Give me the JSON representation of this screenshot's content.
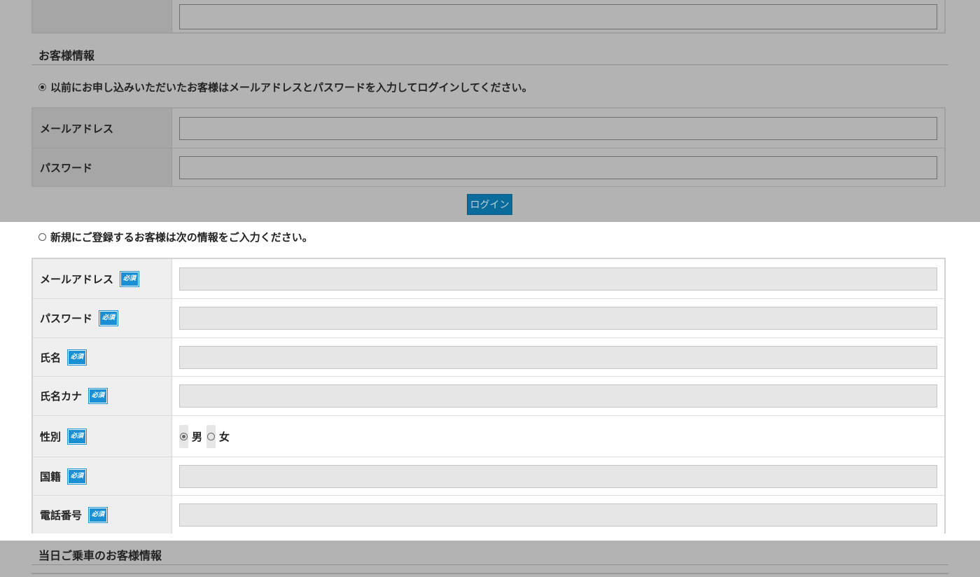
{
  "customer_section": {
    "title": "お客様情報",
    "returning_option": "以前にお申し込みいただいたお客様はメールアドレスとパスワードを入力してログインしてください。",
    "login_fields": [
      {
        "label": "メールアドレス",
        "value": ""
      },
      {
        "label": "パスワード",
        "value": ""
      }
    ],
    "login_button": "ログイン"
  },
  "new_customer": {
    "option_label": "新規にご登録するお客様は次の情報をご入力ください。",
    "required_badge": "必須",
    "fields": [
      {
        "label": "メールアドレス",
        "value": ""
      },
      {
        "label": "パスワード",
        "value": ""
      },
      {
        "label": "氏名",
        "value": ""
      },
      {
        "label": "氏名カナ",
        "value": ""
      },
      {
        "label": "性別",
        "options": [
          "男",
          "女"
        ],
        "selected": "男"
      },
      {
        "label": "国籍",
        "value": ""
      },
      {
        "label": "電話番号",
        "value": ""
      }
    ]
  },
  "boarding_section": {
    "title": "当日ご乗車のお客様情報"
  }
}
